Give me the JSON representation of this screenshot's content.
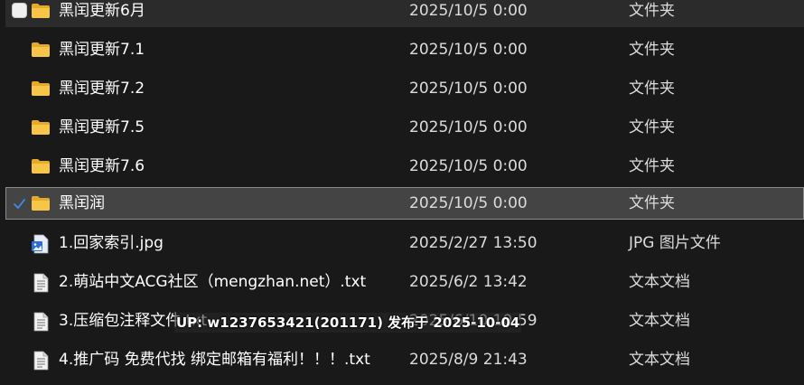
{
  "colors": {
    "background": "#191919",
    "selected_row": "#444444",
    "checkbox_blue": "#3b8eea",
    "folder_yellow": "#f7c548"
  },
  "files": [
    {
      "name": "黑闰更新6月",
      "date": "2025/10/5 0:00",
      "type": "文件夹",
      "icon": "folder-icon",
      "state": "hover"
    },
    {
      "name": "黑闰更新7.1",
      "date": "2025/10/5 0:00",
      "type": "文件夹",
      "icon": "folder-icon",
      "state": "normal"
    },
    {
      "name": "黑闰更新7.2",
      "date": "2025/10/5 0:00",
      "type": "文件夹",
      "icon": "folder-icon",
      "state": "normal"
    },
    {
      "name": "黑闰更新7.5",
      "date": "2025/10/5 0:00",
      "type": "文件夹",
      "icon": "folder-icon",
      "state": "normal"
    },
    {
      "name": "黑闰更新7.6",
      "date": "2025/10/5 0:00",
      "type": "文件夹",
      "icon": "folder-icon",
      "state": "normal"
    },
    {
      "name": "黑闰润",
      "date": "2025/10/5 0:00",
      "type": "文件夹",
      "icon": "folder-icon",
      "state": "selected"
    },
    {
      "name": "1.回家索引.jpg",
      "date": "2025/2/27 13:50",
      "type": "JPG 图片文件",
      "icon": "image-file-icon",
      "state": "normal"
    },
    {
      "name": "2.萌站中文ACG社区（mengzhan.net）.txt",
      "date": "2025/6/2 13:42",
      "type": "文本文档",
      "icon": "text-file-icon",
      "state": "normal"
    },
    {
      "name": "3.压缩包注释文件.txt",
      "date": "2025/6/10 10:59",
      "type": "文本文档",
      "icon": "text-file-icon",
      "state": "normal"
    },
    {
      "name": "4.推广码 免费代找 绑定邮箱有福利！！！.txt",
      "date": "2025/8/9 21:43",
      "type": "文本文档",
      "icon": "text-file-icon",
      "state": "normal"
    }
  ],
  "watermark": "UP: w1237653421(201171) 发布于 2025-10-04"
}
